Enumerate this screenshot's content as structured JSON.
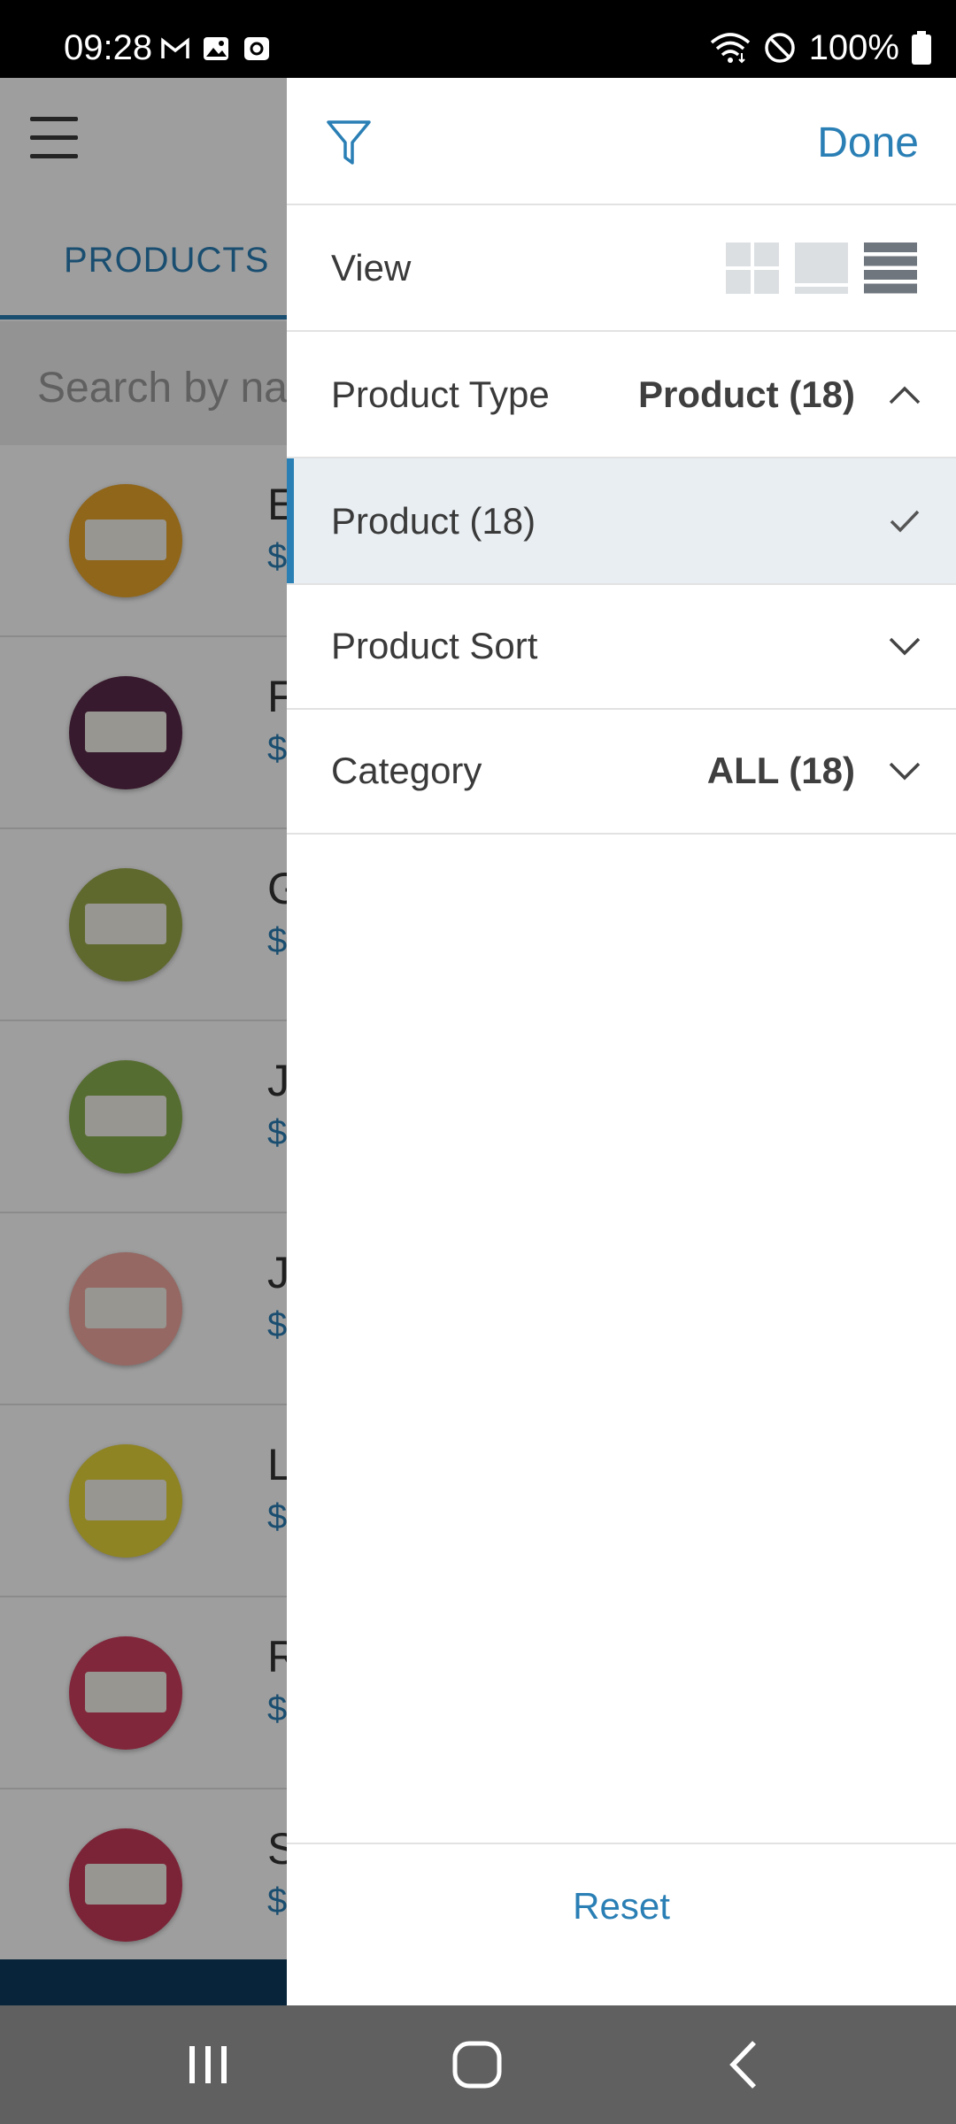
{
  "status_bar": {
    "time": "09:28",
    "battery": "100%",
    "icons": [
      "gmail-icon",
      "gallery-icon",
      "screen-recorder-icon",
      "wifi-icon",
      "do-not-disturb-icon",
      "battery-icon"
    ]
  },
  "background_app": {
    "tab_label": "PRODUCTS",
    "search_placeholder": "Search by na",
    "list_items": [
      {
        "initial": "E",
        "price": "$",
        "thumb_color": "#e8a52a"
      },
      {
        "initial": "F",
        "price": "$",
        "thumb_color": "#5a2a4a"
      },
      {
        "initial": "G",
        "price": "$",
        "thumb_color": "#9aaa4a"
      },
      {
        "initial": "J",
        "price": "$",
        "thumb_color": "#8cb050"
      },
      {
        "initial": "J",
        "price": "$",
        "thumb_color": "#f0a8a0"
      },
      {
        "initial": "L",
        "price": "$",
        "thumb_color": "#e6d63a"
      },
      {
        "initial": "R",
        "price": "$",
        "thumb_color": "#d04060"
      },
      {
        "initial": "S",
        "price": "$",
        "thumb_color": "#c83a5a"
      }
    ]
  },
  "drawer": {
    "done_label": "Done",
    "view": {
      "label": "View",
      "modes": [
        "grid-view-icon",
        "card-view-icon",
        "list-view-icon"
      ],
      "selected": "list-view-icon"
    },
    "product_type": {
      "label": "Product Type",
      "value": "Product (18)",
      "expanded": true
    },
    "product_type_option": {
      "label": "Product (18)",
      "selected": true
    },
    "product_sort": {
      "label": "Product Sort",
      "value": ""
    },
    "category": {
      "label": "Category",
      "value": "ALL (18)"
    },
    "reset_label": "Reset"
  },
  "colors": {
    "accent": "#2a7fb5",
    "selected_row_bg": "#e9eef2",
    "nav_bar": "#606060",
    "bottom_bar": "#0c3a5e"
  }
}
